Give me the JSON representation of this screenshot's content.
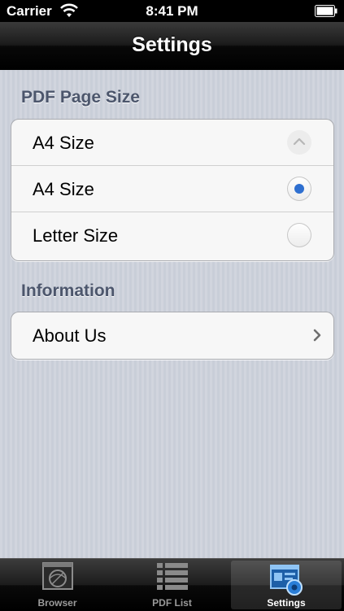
{
  "status": {
    "carrier": "Carrier",
    "time": "8:41 PM"
  },
  "nav": {
    "title": "Settings"
  },
  "pdf_section": {
    "header": "PDF Page Size",
    "rows": [
      {
        "label": "A4 Size",
        "control": "up-arrow"
      },
      {
        "label": "A4 Size",
        "control": "radio-selected"
      },
      {
        "label": "Letter Size",
        "control": "radio-empty"
      }
    ]
  },
  "info_section": {
    "header": "Information",
    "rows": [
      {
        "label": "About Us",
        "control": "chevron"
      }
    ]
  },
  "tabs": [
    {
      "label": "Browser",
      "icon": "browser-icon",
      "active": false
    },
    {
      "label": "PDF List",
      "icon": "list-icon",
      "active": false
    },
    {
      "label": "Settings",
      "icon": "settings-icon",
      "active": true
    }
  ],
  "colors": {
    "accent_blue": "#2e6fd0",
    "section_text": "#4c566c"
  }
}
